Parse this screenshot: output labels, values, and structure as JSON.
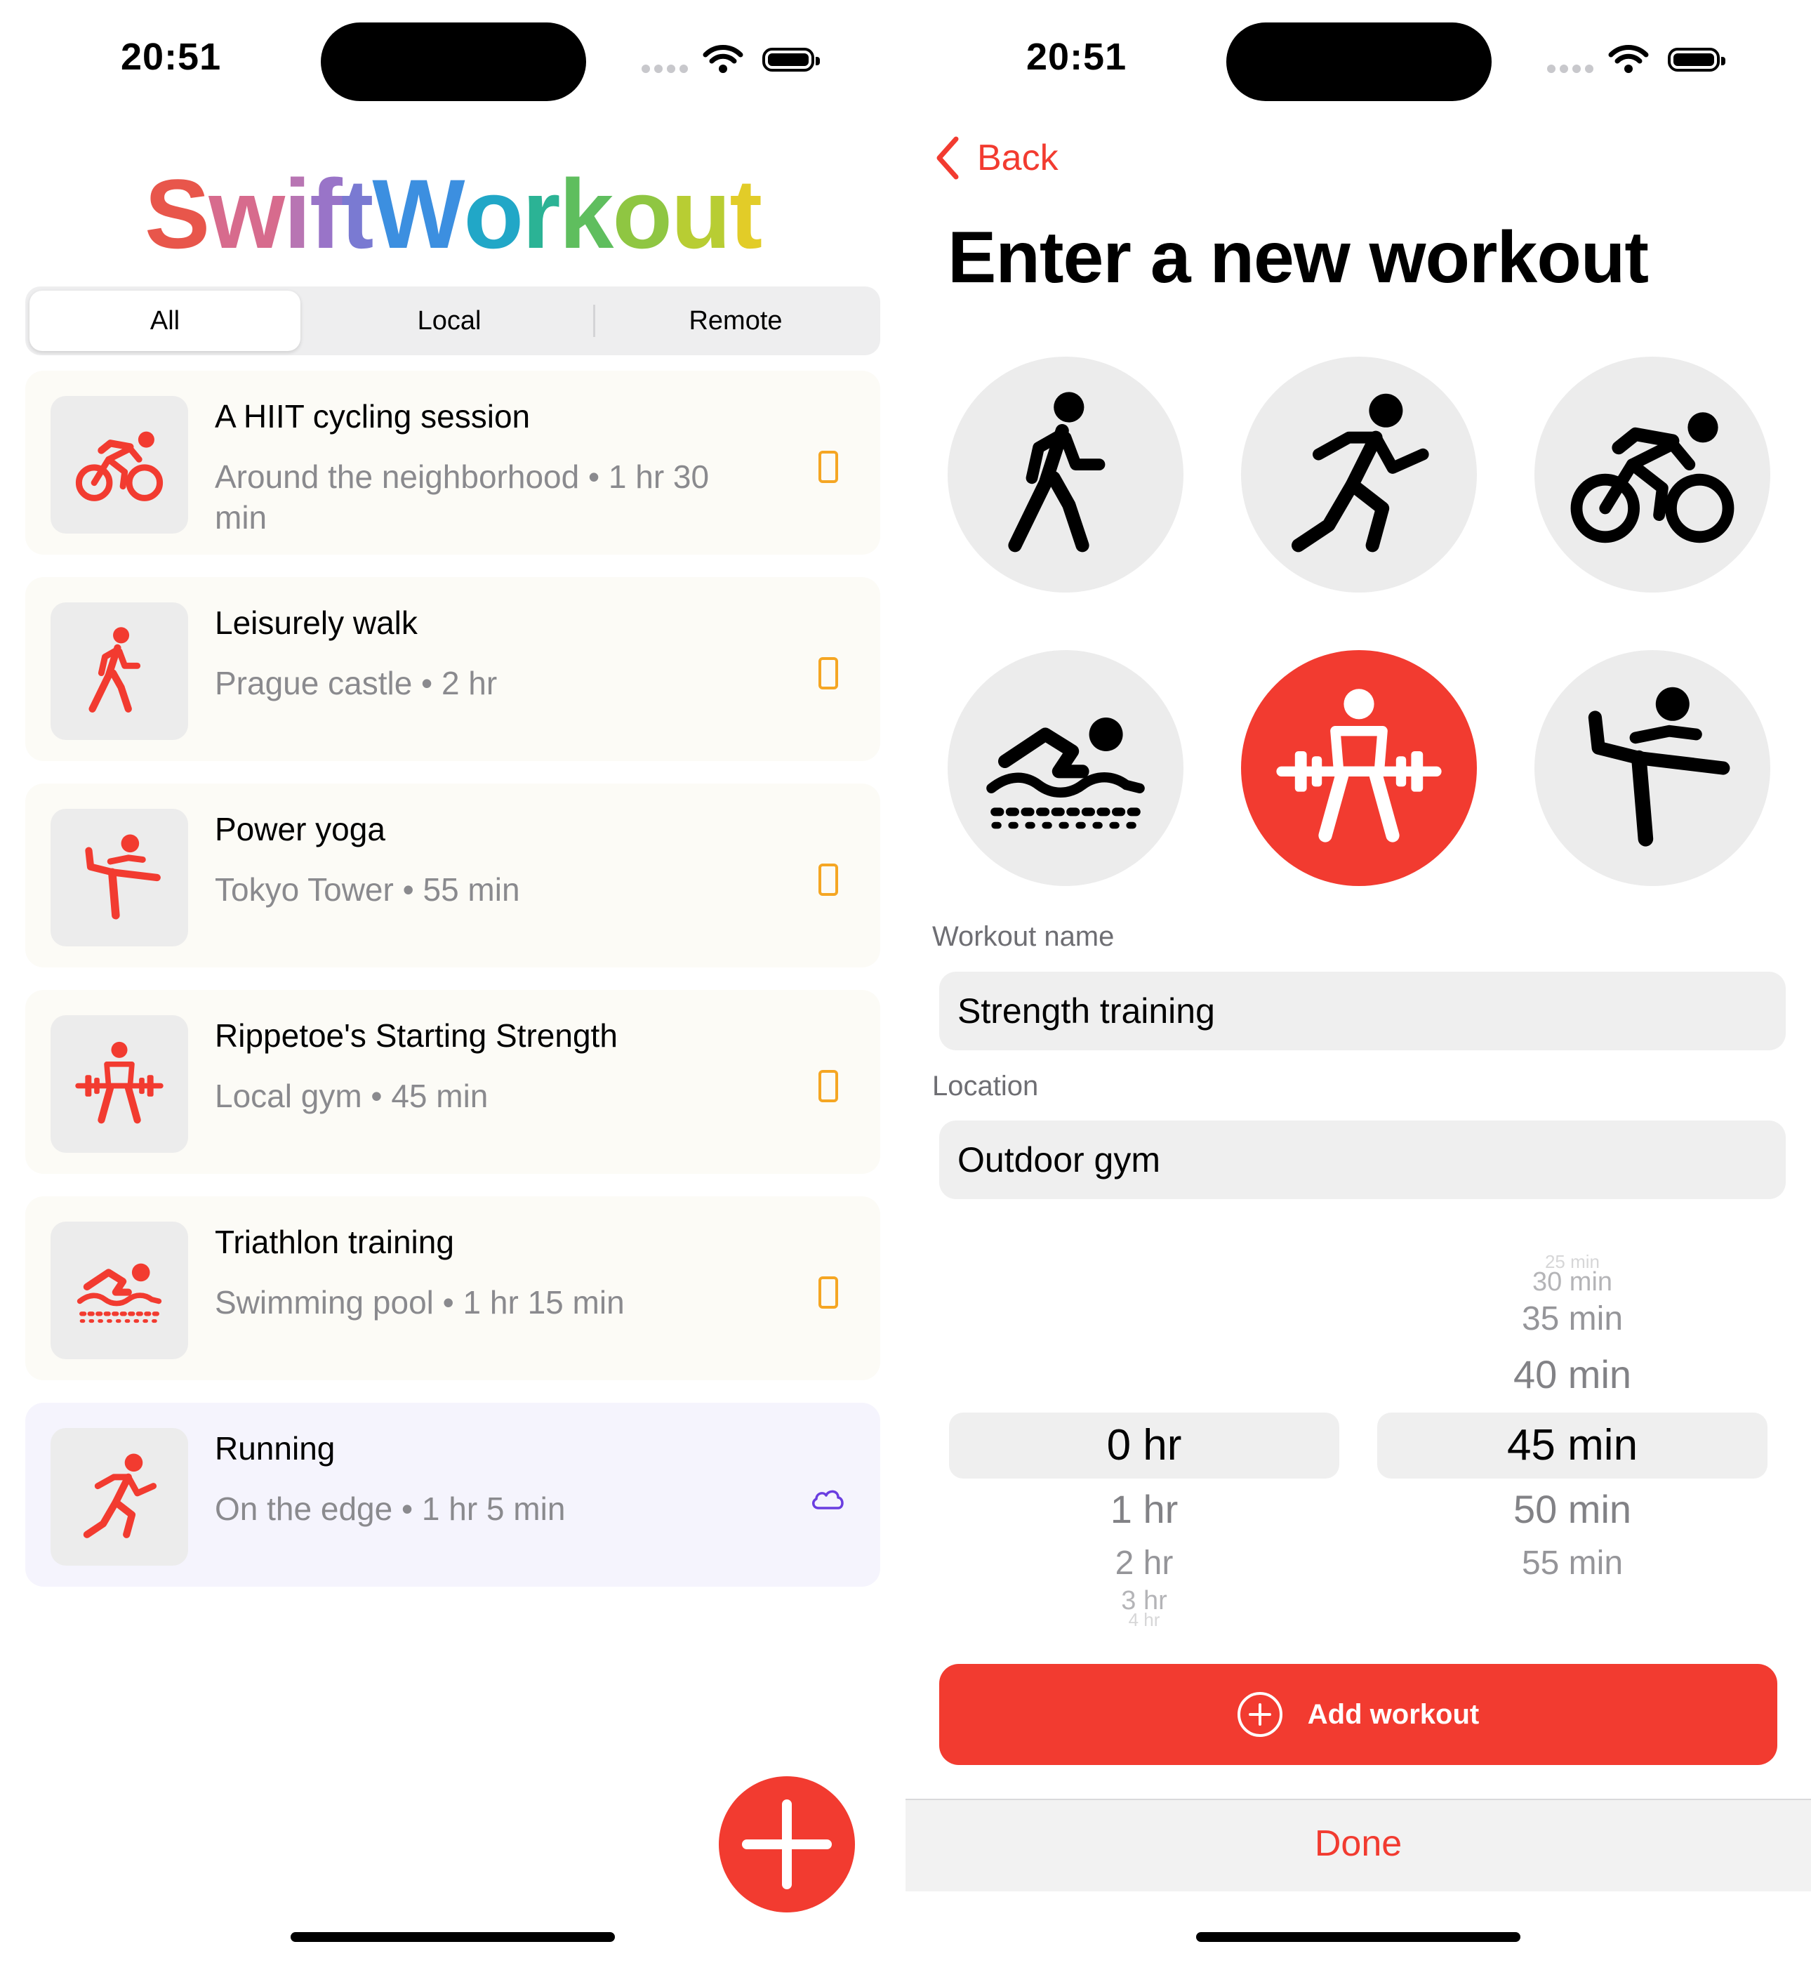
{
  "status_bar": {
    "time": "20:51"
  },
  "list_screen": {
    "title_letters": [
      {
        "ch": "S",
        "color": "#e8564b"
      },
      {
        "ch": "w",
        "color": "#d76b8d"
      },
      {
        "ch": "i",
        "color": "#b875b3"
      },
      {
        "ch": "f",
        "color": "#9974c8"
      },
      {
        "ch": "t",
        "color": "#7a7ad2"
      },
      {
        "ch": "W",
        "color": "#3c8fe0"
      },
      {
        "ch": "o",
        "color": "#21a7c7"
      },
      {
        "ch": "r",
        "color": "#2bb395"
      },
      {
        "ch": "k",
        "color": "#5fbe5e"
      },
      {
        "ch": "o",
        "color": "#8fc642"
      },
      {
        "ch": "u",
        "color": "#b8cd33"
      },
      {
        "ch": "t",
        "color": "#e2cc28"
      }
    ],
    "segments": {
      "all": "All",
      "local": "Local",
      "remote": "Remote",
      "selected": "All"
    },
    "workouts": [
      {
        "title": "A HIIT cycling session",
        "subtitle": "Around the neighborhood • 1 hr 30 min",
        "icon": "cycling-icon",
        "source": "local"
      },
      {
        "title": "Leisurely walk",
        "subtitle": "Prague castle • 2 hr",
        "icon": "walking-icon",
        "source": "local"
      },
      {
        "title": "Power yoga",
        "subtitle": "Tokyo Tower • 55 min",
        "icon": "yoga-icon",
        "source": "local"
      },
      {
        "title": "Rippetoe's Starting Strength",
        "subtitle": "Local gym • 45 min",
        "icon": "strength-icon",
        "source": "local"
      },
      {
        "title": "Triathlon training",
        "subtitle": "Swimming pool • 1 hr 15 min",
        "icon": "swimming-icon",
        "source": "local"
      },
      {
        "title": "Running",
        "subtitle": "On the edge • 1 hr 5 min",
        "icon": "running-icon",
        "source": "remote"
      }
    ]
  },
  "form_screen": {
    "back_label": "Back",
    "title": "Enter a new workout",
    "activity_icons": [
      "walking-icon",
      "running-icon",
      "cycling-icon",
      "swimming-icon",
      "strength-icon",
      "yoga-icon"
    ],
    "selected_activity": "strength-icon",
    "name_label": "Workout name",
    "name_value": "Strength training",
    "location_label": "Location",
    "location_value": "Outdoor gym",
    "hours_picker": {
      "visible": [
        "0 hr",
        "1 hr",
        "2 hr",
        "3 hr",
        "4 hr"
      ],
      "selected": "0 hr"
    },
    "minutes_picker": {
      "visible": [
        "25 min",
        "30 min",
        "35 min",
        "40 min",
        "45 min",
        "50 min",
        "55 min"
      ],
      "selected": "45 min"
    },
    "add_button_label": "Add workout",
    "done_label": "Done"
  },
  "colors": {
    "accent": "#f23b30",
    "local_icon": "#f5a623",
    "remote_icon": "#6a3de0"
  }
}
